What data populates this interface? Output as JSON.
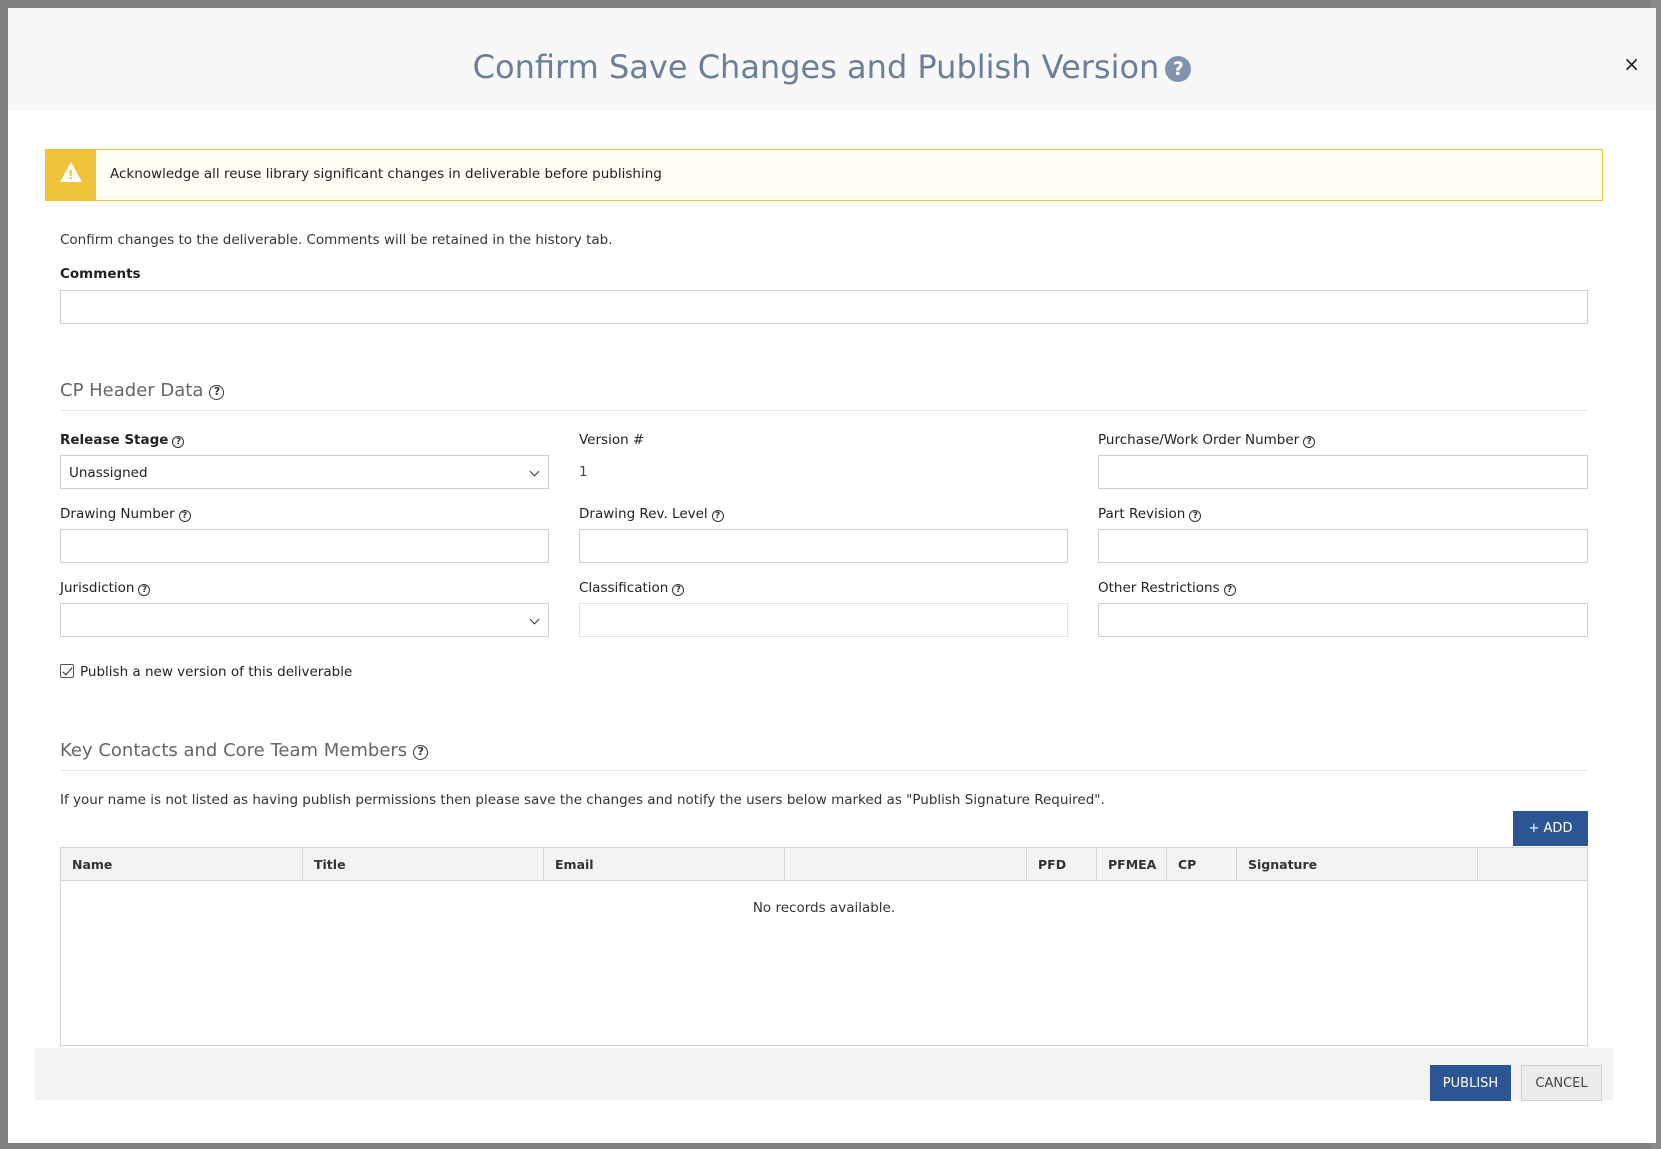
{
  "modal": {
    "title": "Confirm Save Changes and Publish Version",
    "help_glyph": "?",
    "close_glyph": "×"
  },
  "alert": {
    "text": "Acknowledge all reuse library significant changes in deliverable before publishing",
    "icon": "warning-triangle-icon",
    "color": "#f0c33c"
  },
  "intro_text": "Confirm changes to the deliverable. Comments will be retained in the history tab.",
  "comments": {
    "label": "Comments",
    "value": "",
    "placeholder": ""
  },
  "cp_header": {
    "title": "CP Header Data",
    "release_stage": {
      "label": "Release Stage",
      "value": "Unassigned"
    },
    "version": {
      "label": "Version #",
      "value": "1"
    },
    "purchase_order": {
      "label": "Purchase/Work Order Number",
      "value": ""
    },
    "drawing_number": {
      "label": "Drawing Number",
      "value": ""
    },
    "drawing_rev": {
      "label": "Drawing Rev. Level",
      "value": ""
    },
    "part_revision": {
      "label": "Part Revision",
      "value": ""
    },
    "jurisdiction": {
      "label": "Jurisdiction",
      "value": ""
    },
    "classification": {
      "label": "Classification",
      "value": ""
    },
    "other_restrictions": {
      "label": "Other Restrictions",
      "value": ""
    }
  },
  "publish_checkbox": {
    "label": "Publish a new version of this deliverable",
    "checked": true
  },
  "contacts": {
    "title": "Key Contacts and Core Team Members",
    "note": "If your name is not listed as having publish permissions then please save the changes and notify the users below marked as \"Publish Signature Required\".",
    "add_label": "+ ADD",
    "columns": [
      "Name",
      "Title",
      "Email",
      "",
      "PFD",
      "PFMEA",
      "CP",
      "Signature",
      ""
    ],
    "empty_text": "No records available."
  },
  "footer": {
    "publish_label": "PUBLISH",
    "cancel_label": "CANCEL"
  },
  "colors": {
    "primary": "#2c5596",
    "title": "#6a7f99",
    "warning": "#f0c33c"
  }
}
